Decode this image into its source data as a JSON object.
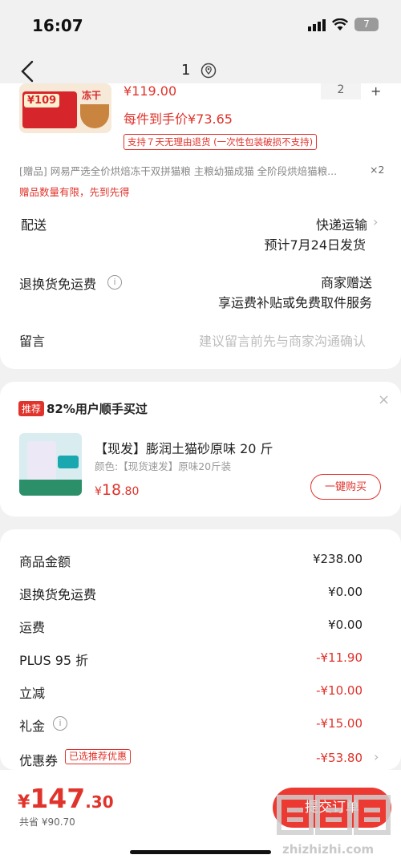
{
  "status_bar": {
    "time": "16:07",
    "battery": "7"
  },
  "nav": {
    "count": "1"
  },
  "product": {
    "thumb_price": "¥109",
    "thumb_tag": "冻干",
    "price_cut": "¥119.00",
    "qty": "2",
    "qty_plus": "+",
    "unit_price_text": "每件到手价¥73.65",
    "return_badge": "支持７天无理由退货 (一次性包装破损不支持)",
    "gift_text": "[赠品] 网易严选全价烘焙冻干双拼猫粮 主粮幼猫成猫 全阶段烘焙猫粮...",
    "gift_qty": "×2",
    "gift_limit": "赠品数量有限，先到先得"
  },
  "delivery": {
    "label": "配送",
    "method": "快递运输",
    "estimate": "预计7月24日发货"
  },
  "return_shipping": {
    "label": "退换货免运费",
    "value": "商家赠送",
    "sub": "享运费补贴或免费取件服务"
  },
  "message": {
    "label": "留言",
    "placeholder": "建议留言前先与商家沟通确认"
  },
  "recommend": {
    "tag": "推荐",
    "title": "82%用户顺手买过",
    "close": "×",
    "product_name": "【现发】膨润土猫砂原味 20 斤",
    "spec": "颜色:【现货速发】原味20斤装",
    "price_yen": "¥",
    "price_int": "18",
    "price_dec": ".80",
    "buy_label": "一键购买"
  },
  "summary": {
    "rows": [
      {
        "label": "商品金额",
        "value": "¥238.00",
        "red": false
      },
      {
        "label": "退换货免运费",
        "value": "¥0.00",
        "red": false
      },
      {
        "label": "运费",
        "value": "¥0.00",
        "red": false
      },
      {
        "label": "PLUS 95 折",
        "value": "-¥11.90",
        "red": true
      },
      {
        "label": "立减",
        "value": "-¥10.00",
        "red": true
      },
      {
        "label": "礼金",
        "value": "-¥15.00",
        "red": true
      },
      {
        "label": "优惠券",
        "value": "-¥53.80",
        "red": true
      }
    ],
    "coupon_tag": "已选推荐优惠"
  },
  "bottom": {
    "yen": "¥",
    "total_int": "147",
    "total_dec": ".30",
    "saved": "共省 ¥90.70",
    "submit_label": "提交订单",
    "watermark": "zhizhizhi.com"
  },
  "colors": {
    "accent": "#e0332b",
    "button": "#ec3a32"
  }
}
